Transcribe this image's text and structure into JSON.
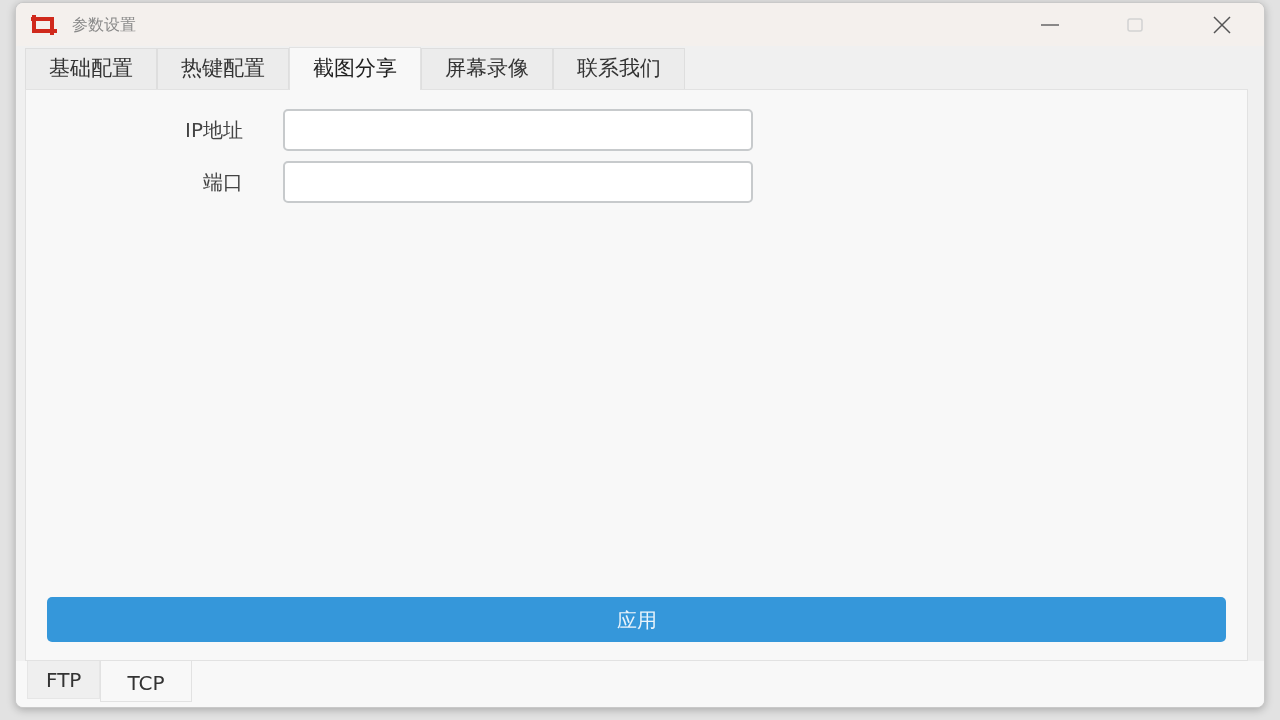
{
  "window": {
    "title": "参数设置"
  },
  "tabs": [
    {
      "label": "基础配置",
      "selected": false
    },
    {
      "label": "热键配置",
      "selected": false
    },
    {
      "label": "截图分享",
      "selected": true
    },
    {
      "label": "屏幕录像",
      "selected": false
    },
    {
      "label": "联系我们",
      "selected": false
    }
  ],
  "form": {
    "fields": [
      {
        "label": "IP地址"
      },
      {
        "label": "端口"
      }
    ]
  },
  "apply_button": {
    "label": "应用"
  },
  "bottom_tabs": [
    {
      "label": "FTP",
      "selected": false
    },
    {
      "label": "TCP",
      "selected": true
    }
  ]
}
